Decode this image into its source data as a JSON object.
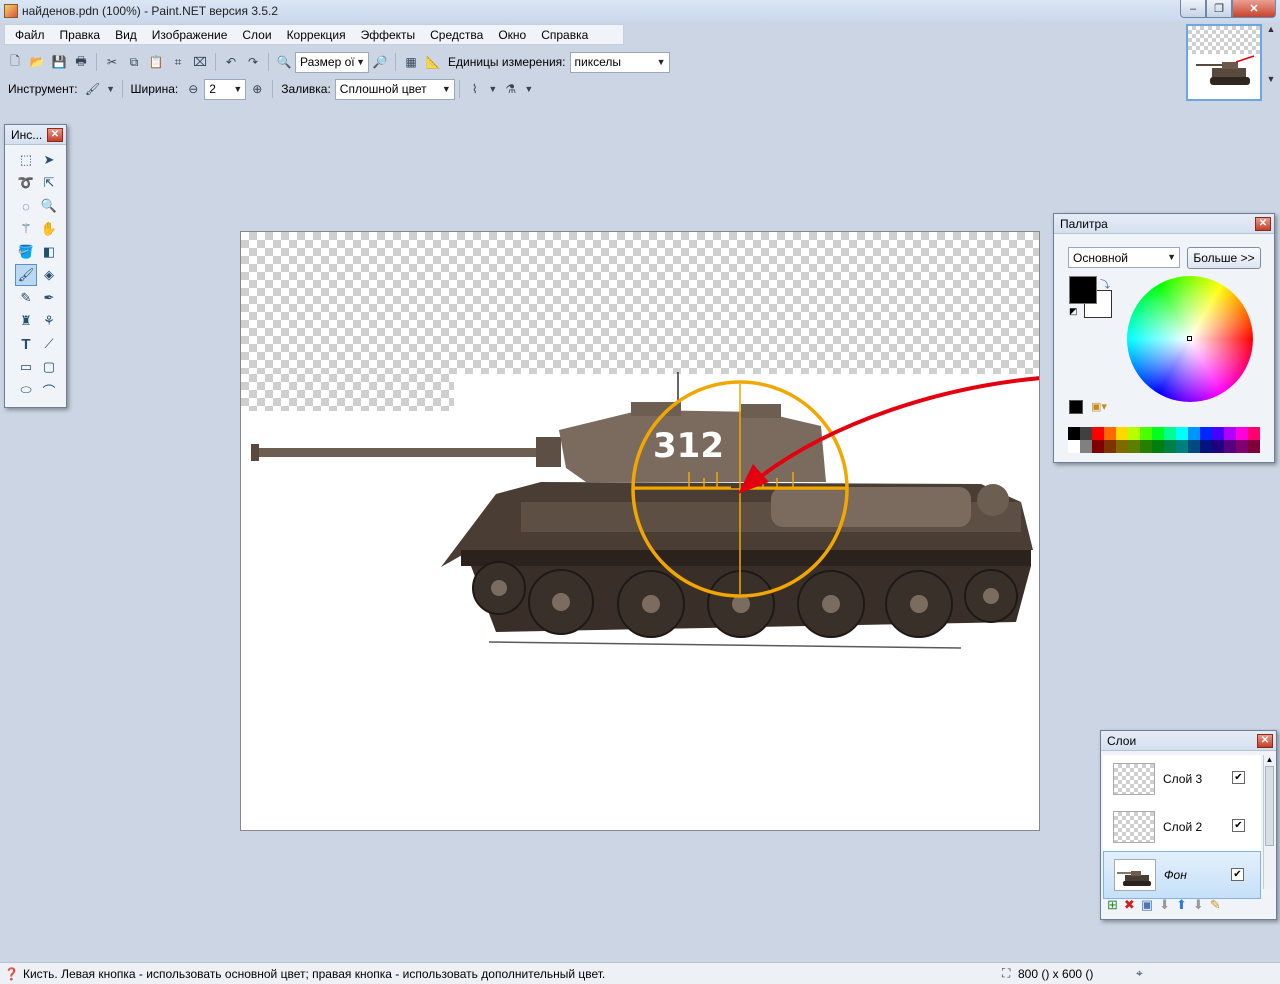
{
  "window": {
    "title": "найденов.pdn (100%) - Paint.NET версия 3.5.2"
  },
  "menu": [
    "Файл",
    "Правка",
    "Вид",
    "Изображение",
    "Слои",
    "Коррекция",
    "Эффекты",
    "Средства",
    "Окно",
    "Справка"
  ],
  "toolbar1": {
    "zoom_value": "Размер ої",
    "units_label": "Единицы измерения:",
    "units_value": "пикселы"
  },
  "toolbar2": {
    "tool_label": "Инструмент:",
    "width_label": "Ширина:",
    "width_value": "2",
    "fill_label": "Заливка:",
    "fill_value": "Сплошной цвет"
  },
  "tools_panel": {
    "title": "Инс..."
  },
  "canvas": {
    "number_on_tank": "312",
    "checker": "transparent",
    "accent_red": "#e3000f",
    "crosshair": "#f2a700"
  },
  "palette": {
    "title": "Палитра",
    "mode_value": "Основной",
    "more_button": "Больше >>",
    "primary": "#000000",
    "secondary": "#ffffff"
  },
  "layers": {
    "title": "Слои",
    "items": [
      {
        "name": "Слой 3",
        "checked": true
      },
      {
        "name": "Слой 2",
        "checked": true
      },
      {
        "name": "Фон",
        "checked": true
      }
    ]
  },
  "status": {
    "hint": "Кисть. Левая кнопка - использовать основной цвет; правая кнопка - использовать дополнительный цвет.",
    "size": "800 () x 600 ()"
  }
}
